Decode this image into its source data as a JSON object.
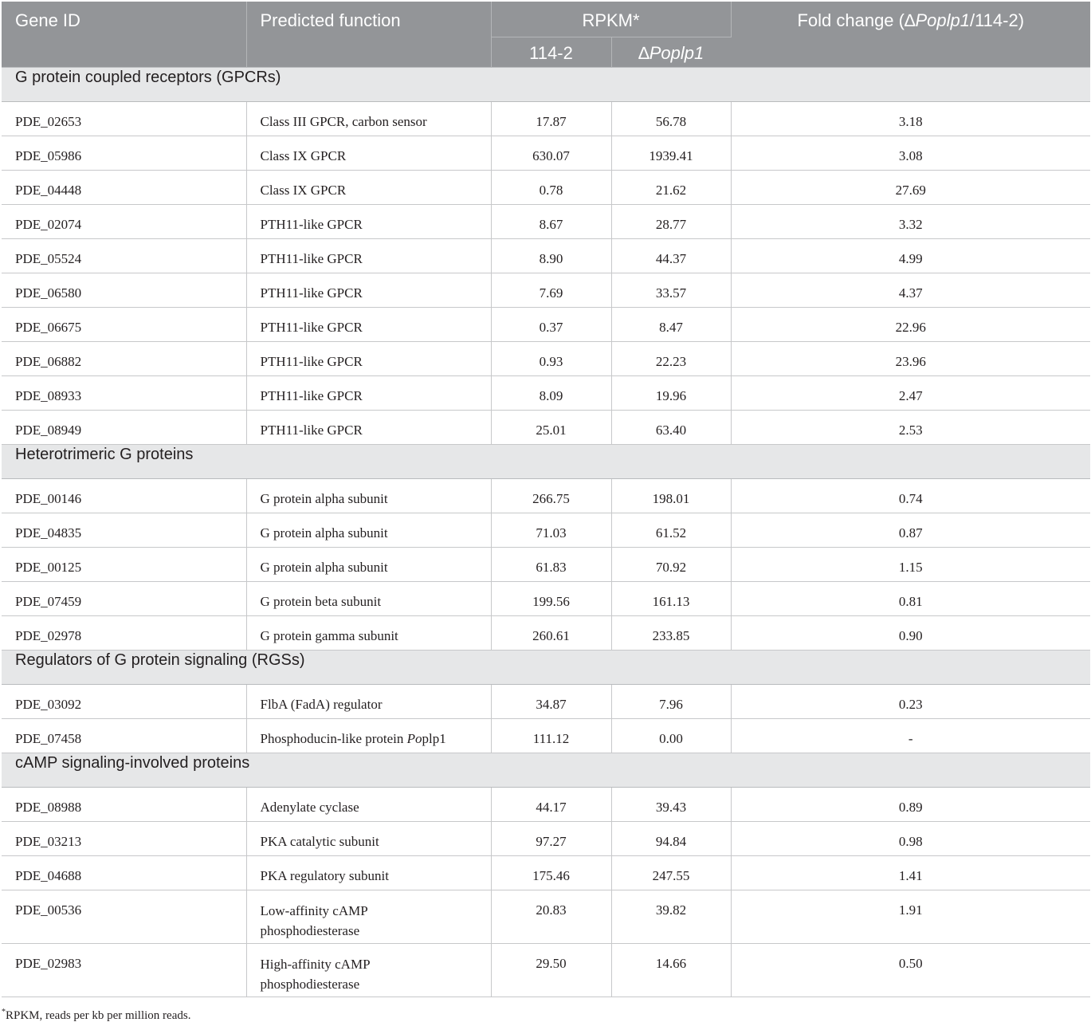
{
  "table": {
    "headers": {
      "gene_id": "Gene ID",
      "predicted_function": "Predicted function",
      "rpkm": "RPKM*",
      "col_114_2": "114-2",
      "col_delta_prefix": "∆",
      "col_delta_name": "Poplp1",
      "fold_change_prefix": "Fold change (∆",
      "fold_change_name": "Poplp1",
      "fold_change_suffix": "/114-2)"
    },
    "sections": [
      {
        "title": "G protein coupled receptors (GPCRs)",
        "rows": [
          {
            "gene": "PDE_02653",
            "function": "Class III GPCR, carbon sensor",
            "rpkm_114_2": "17.87",
            "rpkm_delta": "56.78",
            "fold": "3.18"
          },
          {
            "gene": "PDE_05986",
            "function": "Class IX GPCR",
            "rpkm_114_2": "630.07",
            "rpkm_delta": "1939.41",
            "fold": "3.08"
          },
          {
            "gene": "PDE_04448",
            "function": "Class IX GPCR",
            "rpkm_114_2": "0.78",
            "rpkm_delta": "21.62",
            "fold": "27.69"
          },
          {
            "gene": "PDE_02074",
            "function": "PTH11-like GPCR",
            "rpkm_114_2": "8.67",
            "rpkm_delta": "28.77",
            "fold": "3.32"
          },
          {
            "gene": "PDE_05524",
            "function": "PTH11-like GPCR",
            "rpkm_114_2": "8.90",
            "rpkm_delta": "44.37",
            "fold": "4.99"
          },
          {
            "gene": "PDE_06580",
            "function": "PTH11-like GPCR",
            "rpkm_114_2": "7.69",
            "rpkm_delta": "33.57",
            "fold": "4.37"
          },
          {
            "gene": "PDE_06675",
            "function": "PTH11-like GPCR",
            "rpkm_114_2": "0.37",
            "rpkm_delta": "8.47",
            "fold": "22.96"
          },
          {
            "gene": "PDE_06882",
            "function": "PTH11-like GPCR",
            "rpkm_114_2": "0.93",
            "rpkm_delta": "22.23",
            "fold": "23.96"
          },
          {
            "gene": "PDE_08933",
            "function": "PTH11-like GPCR",
            "rpkm_114_2": "8.09",
            "rpkm_delta": "19.96",
            "fold": "2.47"
          },
          {
            "gene": "PDE_08949",
            "function": "PTH11-like GPCR",
            "rpkm_114_2": "25.01",
            "rpkm_delta": "63.40",
            "fold": "2.53"
          }
        ]
      },
      {
        "title": "Heterotrimeric G proteins",
        "rows": [
          {
            "gene": "PDE_00146",
            "function": "G protein alpha subunit",
            "rpkm_114_2": "266.75",
            "rpkm_delta": "198.01",
            "fold": "0.74"
          },
          {
            "gene": "PDE_04835",
            "function": "G protein alpha subunit",
            "rpkm_114_2": "71.03",
            "rpkm_delta": "61.52",
            "fold": "0.87"
          },
          {
            "gene": "PDE_00125",
            "function": "G protein alpha subunit",
            "rpkm_114_2": "61.83",
            "rpkm_delta": "70.92",
            "fold": "1.15"
          },
          {
            "gene": "PDE_07459",
            "function": "G protein beta subunit",
            "rpkm_114_2": "199.56",
            "rpkm_delta": "161.13",
            "fold": "0.81"
          },
          {
            "gene": "PDE_02978",
            "function": "G protein gamma subunit",
            "rpkm_114_2": "260.61",
            "rpkm_delta": "233.85",
            "fold": "0.90"
          }
        ]
      },
      {
        "title": "Regulators of G protein signaling (RGSs)",
        "rows": [
          {
            "gene": "PDE_03092",
            "function": "FlbA (FadA) regulator",
            "rpkm_114_2": "34.87",
            "rpkm_delta": "7.96",
            "fold": "0.23"
          },
          {
            "gene": "PDE_07458",
            "function_prefix": "Phosphoducin-like protein ",
            "function_italic": "Po",
            "function_suffix": "plp1",
            "rpkm_114_2": "111.12",
            "rpkm_delta": "0.00",
            "fold": "-"
          }
        ]
      },
      {
        "title": "cAMP signaling-involved proteins",
        "rows": [
          {
            "gene": "PDE_08988",
            "function": "Adenylate cyclase",
            "rpkm_114_2": "44.17",
            "rpkm_delta": "39.43",
            "fold": "0.89"
          },
          {
            "gene": "PDE_03213",
            "function": "PKA catalytic subunit",
            "rpkm_114_2": "97.27",
            "rpkm_delta": "94.84",
            "fold": "0.98"
          },
          {
            "gene": "PDE_04688",
            "function": "PKA regulatory subunit",
            "rpkm_114_2": "175.46",
            "rpkm_delta": "247.55",
            "fold": "1.41"
          },
          {
            "gene": "PDE_00536",
            "function_line1": "Low-affinity cAMP",
            "function_line2": "phosphodiesterase",
            "rpkm_114_2": "20.83",
            "rpkm_delta": "39.82",
            "fold": "1.91"
          },
          {
            "gene": "PDE_02983",
            "function_line1": "High-affinity cAMP",
            "function_line2": "phosphodiesterase",
            "rpkm_114_2": "29.50",
            "rpkm_delta": "14.66",
            "fold": "0.50"
          }
        ]
      }
    ]
  },
  "footnote": {
    "marker": "*",
    "text": "RPKM, reads per kb per million reads."
  },
  "colors": {
    "header_bg": "#939598",
    "section_bg": "#e6e7e8",
    "border": "#c7c8ca"
  }
}
